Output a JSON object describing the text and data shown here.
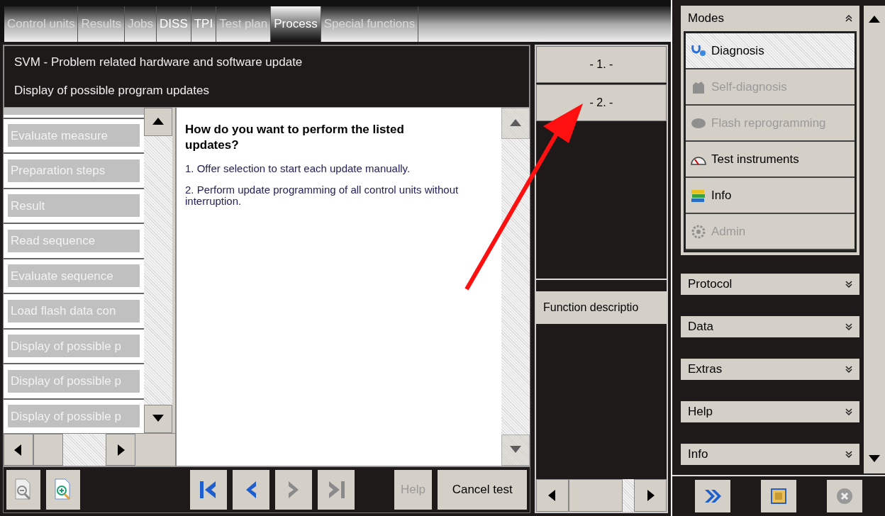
{
  "tabs": [
    {
      "label": "Control units",
      "selected": false,
      "disabled": true
    },
    {
      "label": "Results",
      "selected": false,
      "disabled": true
    },
    {
      "label": "Jobs",
      "selected": false,
      "disabled": true
    },
    {
      "label": "DISS",
      "selected": false,
      "disabled": false
    },
    {
      "label": "TPI",
      "selected": false,
      "disabled": false
    },
    {
      "label": "Test plan",
      "selected": false,
      "disabled": true
    },
    {
      "label": "Process",
      "selected": true,
      "disabled": false
    },
    {
      "label": "Special functions",
      "selected": false,
      "disabled": true
    }
  ],
  "header": {
    "title": "SVM - Problem related hardware and software update",
    "subtitle": "Display of possible program updates"
  },
  "steps": [
    {
      "label": "Evaluate measure",
      "disabled": true
    },
    {
      "label": "Preparation steps",
      "disabled": true
    },
    {
      "label": "Result",
      "disabled": true
    },
    {
      "label": "Read sequence",
      "disabled": true
    },
    {
      "label": "Evaluate sequence",
      "disabled": true
    },
    {
      "label": "Load flash data con",
      "disabled": true
    },
    {
      "label": "Display of possible p",
      "disabled": true
    },
    {
      "label": "Display of possible p",
      "disabled": true
    },
    {
      "label": "Display of possible p",
      "disabled": true
    }
  ],
  "content": {
    "question": "How do you want to perform the listed updates?",
    "options": [
      "1. Offer selection to start each update manually.",
      "2. Perform update programming of all control units without interruption."
    ]
  },
  "choices": [
    "- 1. -",
    "- 2. -"
  ],
  "function_description": "Function descriptio",
  "toolbar": {
    "nav": [
      {
        "kind": "first",
        "disabled": false
      },
      {
        "kind": "back",
        "disabled": false
      },
      {
        "kind": "forward",
        "disabled": true
      },
      {
        "kind": "last",
        "disabled": true
      }
    ],
    "help": {
      "label": "Help",
      "disabled": true
    },
    "cancel": "Cancel test"
  },
  "modes": {
    "title": "Modes",
    "expanded": true,
    "items": [
      {
        "kind": "diagnosis",
        "label": "Diagnosis",
        "selected": true,
        "disabled": false
      },
      {
        "kind": "self",
        "label": "Self-diagnosis",
        "selected": false,
        "disabled": true
      },
      {
        "kind": "flash",
        "label": "Flash reprogramming",
        "selected": false,
        "disabled": true
      },
      {
        "kind": "instruments",
        "label": "Test instruments",
        "selected": false,
        "disabled": false
      },
      {
        "kind": "info",
        "label": "Info",
        "selected": false,
        "disabled": false
      },
      {
        "kind": "admin",
        "label": "Admin",
        "selected": false,
        "disabled": true
      }
    ]
  },
  "sections": [
    {
      "label": "Protocol",
      "expanded": false
    },
    {
      "label": "Data",
      "expanded": false
    },
    {
      "label": "Extras",
      "expanded": false
    },
    {
      "label": "Help",
      "expanded": false
    },
    {
      "label": "Info",
      "expanded": false
    }
  ]
}
